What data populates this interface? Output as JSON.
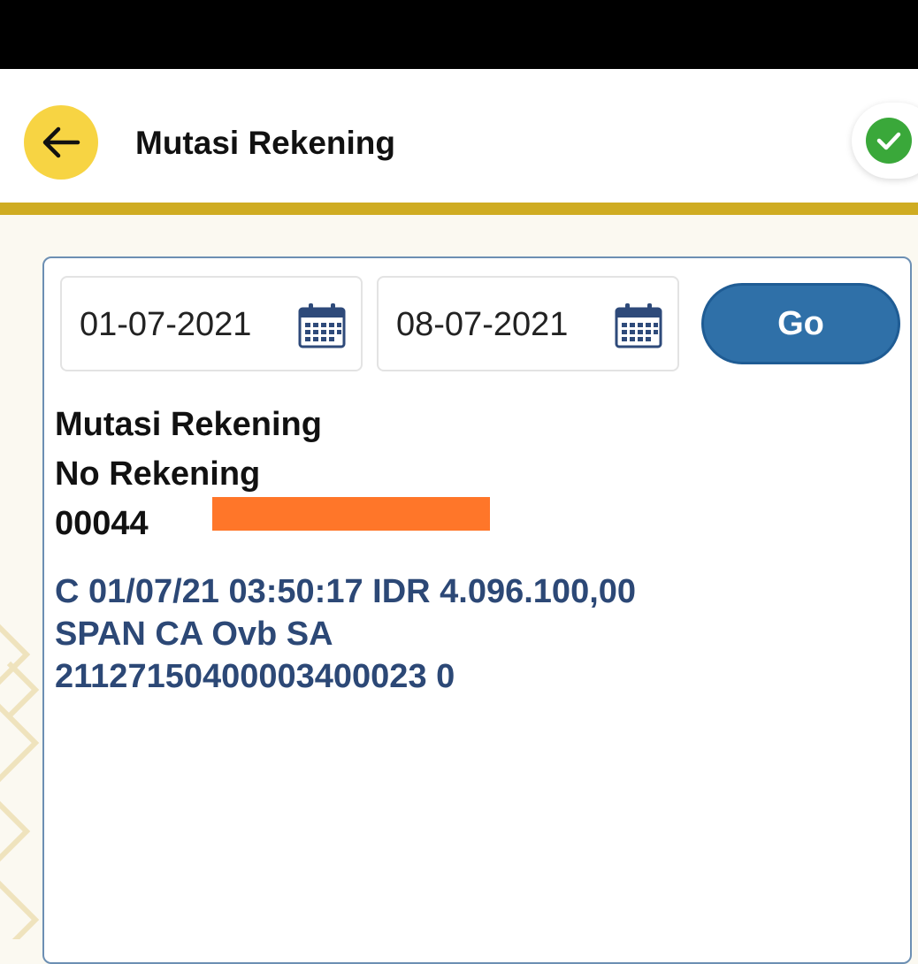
{
  "header": {
    "title": "Mutasi Rekening",
    "back_icon": "arrow-left-icon",
    "status_icon": "check-circle-icon"
  },
  "filter": {
    "date_from": "01-07-2021",
    "date_to": "08-07-2021",
    "calendar_icon": "calendar-icon",
    "go_label": "Go"
  },
  "account": {
    "heading": "Mutasi Rekening",
    "label": "No Rekening",
    "number_visible": "00044"
  },
  "transactions": [
    {
      "line1": "C 01/07/21 03:50:17 IDR 4.096.100,00",
      "line2": "SPAN CA Ovb SA",
      "line3": "21127150400003400023 0"
    }
  ],
  "colors": {
    "accent_yellow": "#f7d443",
    "gold_rule": "#cfac22",
    "go_button": "#2f70a8",
    "transaction_text": "#2c4876",
    "redaction": "#ff7629",
    "success": "#3aa83a"
  }
}
